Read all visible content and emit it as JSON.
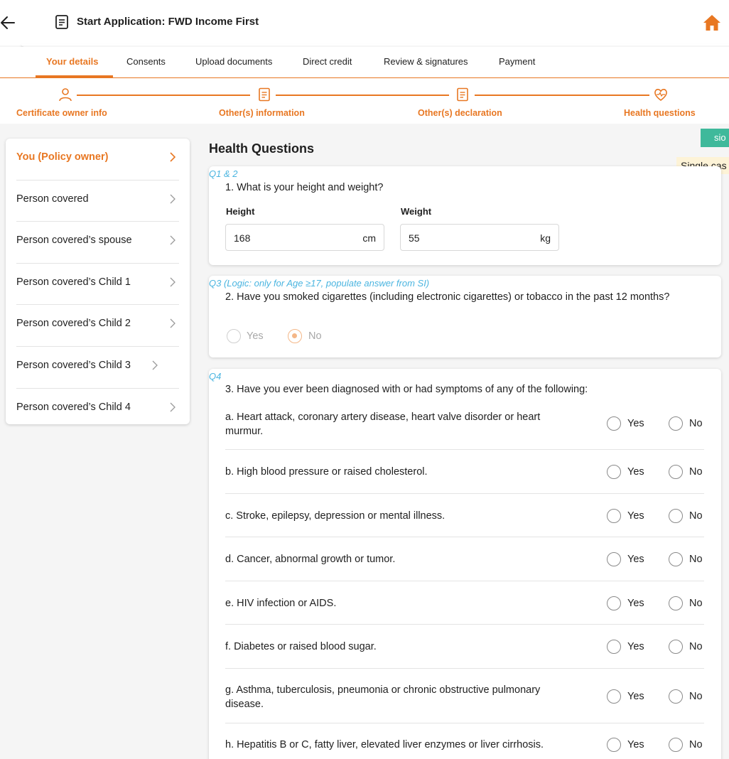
{
  "header": {
    "title": "Start Application: FWD Income First"
  },
  "tabs": [
    {
      "label": "Your details",
      "active": true
    },
    {
      "label": "Consents"
    },
    {
      "label": "Upload documents"
    },
    {
      "label": "Direct credit"
    },
    {
      "label": "Review & signatures"
    },
    {
      "label": "Payment"
    }
  ],
  "steps": [
    {
      "label": "Certificate owner info",
      "icon": "person-icon"
    },
    {
      "label": "Other(s) information",
      "icon": "document-icon"
    },
    {
      "label": "Other(s) declaration",
      "icon": "document-icon"
    },
    {
      "label": "Health questions",
      "icon": "heart-pulse-icon"
    }
  ],
  "sidebar": {
    "items": [
      {
        "label": "You (Policy owner)",
        "active": true
      },
      {
        "label": "Person covered"
      },
      {
        "label": "Person covered’s spouse"
      },
      {
        "label": "Person covered’s Child 1"
      },
      {
        "label": "Person covered’s Child 2"
      },
      {
        "label": "Person covered’s Child 3"
      },
      {
        "label": "Person covered’s Child 4"
      }
    ]
  },
  "main": {
    "title": "Health Questions",
    "badge": "sio",
    "note": "Single cas"
  },
  "q1": {
    "tag": "Q1 & 2",
    "question": "1. What is your height and weight?",
    "height_label": "Height",
    "height_value": "168",
    "height_unit": "cm",
    "weight_label": "Weight",
    "weight_value": "55",
    "weight_unit": "kg"
  },
  "q2": {
    "tag": "Q3 (Logic: only for Age ≥17, populate answer from SI)",
    "question": "2. Have you smoked cigarettes (including electronic cigarettes) or tobacco in the past 12 months?",
    "yes_label": "Yes",
    "no_label": "No",
    "selected": "No"
  },
  "q3": {
    "tag": "Q4",
    "question": "3. Have you ever been diagnosed with or had symptoms of any of the following:",
    "yes_label": "Yes",
    "no_label": "No",
    "items": [
      "a. Heart attack, coronary artery disease, heart valve disorder or heart murmur.",
      "b. High blood pressure or raised cholesterol.",
      "c. Stroke, epilepsy, depression or mental illness.",
      "d. Cancer, abnormal growth or tumor.",
      "e. HIV infection or AIDS.",
      "f. Diabetes or raised blood sugar.",
      "g. Asthma, tuberculosis, pneumonia or chronic obstructive pulmonary disease.",
      "h. Hepatitis B or C, fatty liver, elevated liver enzymes or liver cirrhosis."
    ]
  },
  "colors": {
    "accent": "#e87722",
    "link_blue": "#4bb5e0",
    "badge_green": "#3fb99b",
    "note_yellow": "#fdf3d7"
  }
}
